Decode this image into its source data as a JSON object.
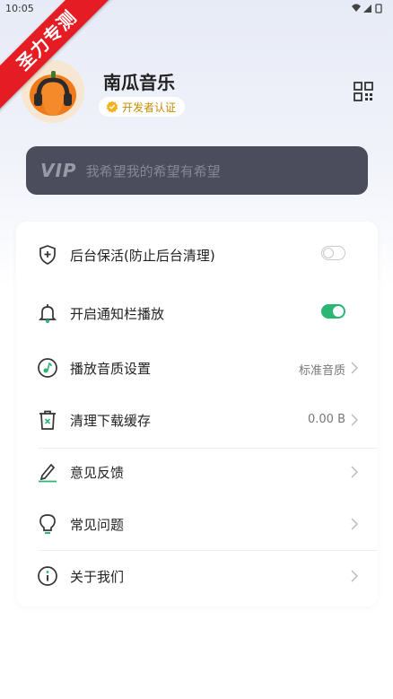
{
  "status_bar": {
    "time": "10:05"
  },
  "ribbon": {
    "text": "圣力专测"
  },
  "profile": {
    "app_name": "南瓜音乐",
    "badge_text": "开发者认证",
    "avatar_icon": "pumpkin-headphones-icon",
    "qr_icon": "qr-code-icon"
  },
  "vip": {
    "logo": "VIP",
    "slogan": "我希望我的希望有希望"
  },
  "colors": {
    "accent": "#2bb673",
    "vip_bg": "#4b4c5c",
    "badge": "#c68a00"
  },
  "settings": [
    {
      "label": "后台保活(防止后台清理)",
      "icon": "shield-plus-icon",
      "control": "toggle",
      "enabled": false
    },
    {
      "label": "开启通知栏播放",
      "icon": "bell-icon",
      "control": "toggle",
      "enabled": true
    },
    {
      "label": "播放音质设置",
      "icon": "music-note-icon",
      "value": "标准音质"
    },
    {
      "label": "清理下载缓存",
      "icon": "trash-icon",
      "value": "0.00 B"
    },
    {
      "label": "意见反馈",
      "icon": "pencil-icon"
    },
    {
      "label": "常见问题",
      "icon": "lightbulb-icon"
    },
    {
      "label": "关于我们",
      "icon": "info-icon"
    }
  ]
}
